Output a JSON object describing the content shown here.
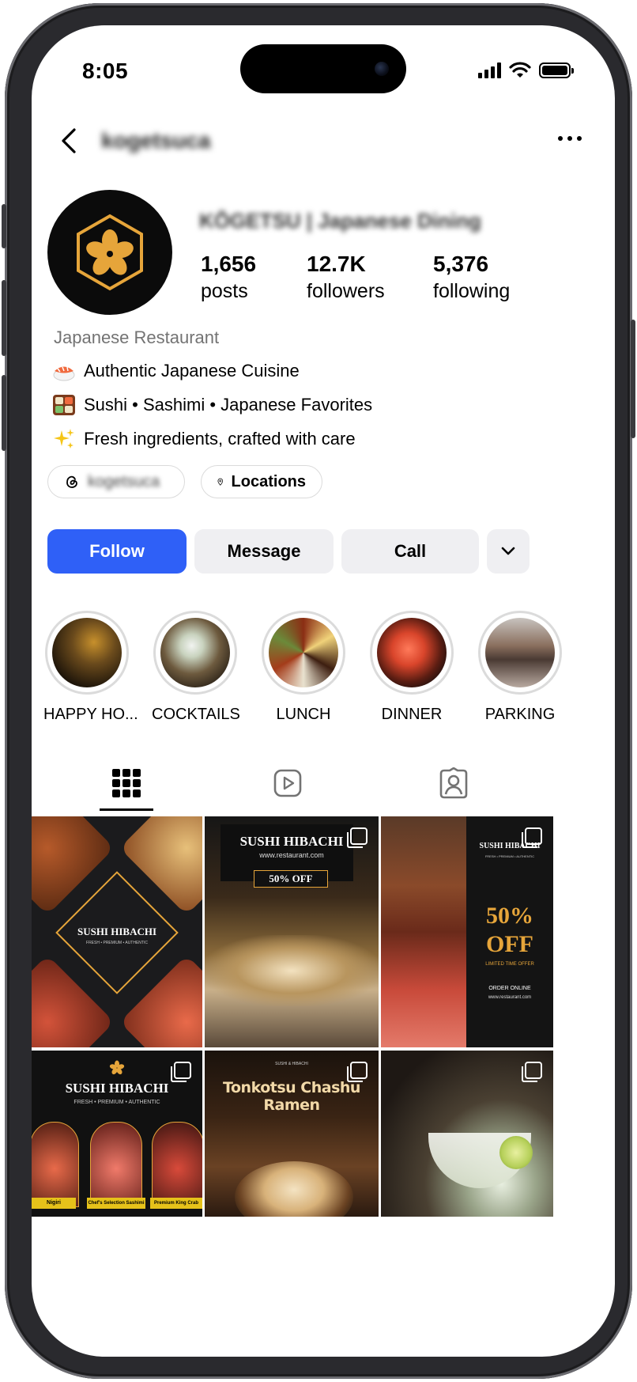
{
  "status_bar": {
    "time": "8:05"
  },
  "profile": {
    "username": "kogetsuca",
    "display_name": "KŌGETSU | Japanese Dining",
    "stats": [
      {
        "count": "1,656",
        "label": "posts"
      },
      {
        "count": "12.7K",
        "label": "followers"
      },
      {
        "count": "5,376",
        "label": "following"
      }
    ],
    "category": "Japanese Restaurant",
    "bio_lines": [
      {
        "icon": "sushi-icon",
        "text": "Authentic Japanese Cuisine"
      },
      {
        "icon": "bento-icon",
        "text": "Sushi • Sashimi • Japanese Favorites"
      },
      {
        "icon": "sparkles-icon",
        "text": "Fresh ingredients, crafted with care"
      }
    ],
    "links": {
      "threads_handle": "kogetsuca",
      "locations_label": "Locations"
    }
  },
  "actions": {
    "follow": "Follow",
    "message": "Message",
    "call": "Call"
  },
  "highlights": [
    {
      "label": "HAPPY HO..."
    },
    {
      "label": "COCKTAILS"
    },
    {
      "label": "LUNCH"
    },
    {
      "label": "DINNER"
    },
    {
      "label": "PARKING"
    }
  ],
  "posts": [
    {
      "title": "SUSHI HIBACHI",
      "subtitle": "FRESH • PREMIUM • AUTHENTIC"
    },
    {
      "title": "SUSHI HIBACHI",
      "url": "www.restaurant.com",
      "badge": "50% OFF"
    },
    {
      "title": "SUSHI HIBACHI",
      "subtitle": "FRESH • PREMIUM • AUTHENTIC",
      "promo": "50% OFF",
      "promo_sub": "LIMITED TIME OFFER",
      "cta": "ORDER ONLINE",
      "url": "www.restaurant.com"
    },
    {
      "title": "SUSHI HIBACHI",
      "subtitle": "FRESH • PREMIUM • AUTHENTIC",
      "captions": [
        "Nigiri",
        "Chef's Selection Sashimi",
        "Premium King Crab"
      ]
    },
    {
      "small": "SUSHI & HIBACHI",
      "title": "Tonkotsu Chashu Ramen"
    },
    {}
  ],
  "colors": {
    "follow_blue": "#2f60f7",
    "brand_gold": "#e6a53a"
  }
}
